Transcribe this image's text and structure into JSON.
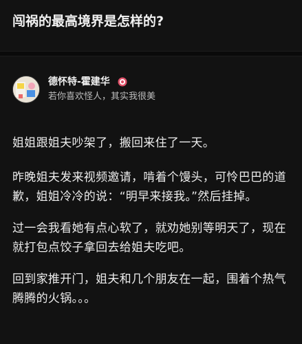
{
  "question": {
    "title": "闯祸的最高境界是怎样的?"
  },
  "author": {
    "name": "德怀特-霍建华",
    "bio": "若你喜欢怪人，其实我很美",
    "badge_icon": "badge-icon",
    "badge_color": "#e0526a",
    "avatar_icon": "avatar-icon"
  },
  "answer": {
    "paragraphs": [
      "姐姐跟姐夫吵架了，搬回来住了一天。",
      "昨晚姐夫发来视频邀请，啃着个馒头，可怜巴巴的道歉，姐姐冷冷的说：“明早来接我。”然后挂掉。",
      "过一会我看她有点心软了，就劝她别等明天了，现在就打包点饺子拿回去给姐夫吃吧。",
      "回到家推开门，姐夫和几个朋友在一起，围着个热气腾腾的火锅。。。"
    ]
  },
  "colors": {
    "background": "#121212",
    "text": "#ececec",
    "muted_text": "#bdbdbd"
  }
}
